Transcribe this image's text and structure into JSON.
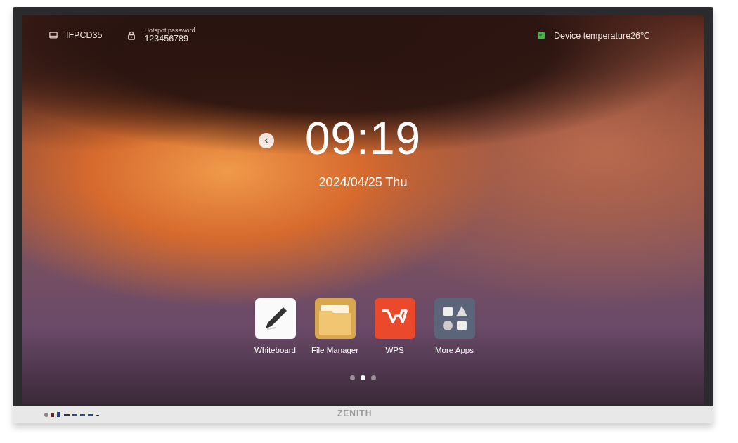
{
  "status_bar": {
    "device_name": "IFPCD35",
    "hotspot_label": "Hotspot password",
    "hotspot_password": "123456789",
    "temperature": "Device temperature26℃"
  },
  "clock": {
    "time": "09:19",
    "date": "2024/04/25 Thu"
  },
  "apps": [
    {
      "kind": "whiteboard",
      "label": "Whiteboard"
    },
    {
      "kind": "files",
      "label": "File Manager"
    },
    {
      "kind": "wps",
      "label": "WPS"
    },
    {
      "kind": "more",
      "label": "More Apps"
    }
  ],
  "page_dots": [
    {
      "selected": false
    },
    {
      "selected": true
    },
    {
      "selected": false
    }
  ],
  "bezel": {
    "brand": "ZENITH"
  }
}
